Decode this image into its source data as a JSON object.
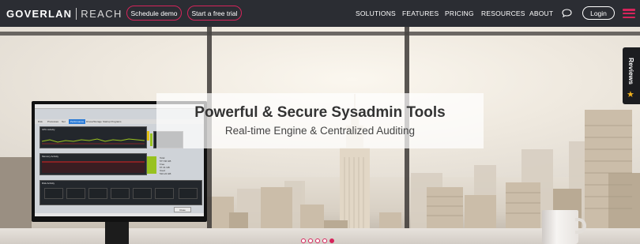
{
  "brand": {
    "logo_left": "GOVERLAN",
    "logo_right": "REACH",
    "accent_color": "#d6245b"
  },
  "nav": {
    "schedule_demo": "Schedule demo",
    "free_trial": "Start a free trial",
    "menu": [
      "SOLUTIONS",
      "FEATURES",
      "PRICING",
      "RESOURCES",
      "ABOUT"
    ],
    "chat_icon": "chat-bubble-icon",
    "login": "Login",
    "menu_icon": "hamburger-icon"
  },
  "hero": {
    "title": "Powerful & Secure Sysadmin Tools",
    "subtitle": "Real-time Engine & Centralized Auditing"
  },
  "screen": {
    "tabs": [
      "Disk",
      "Processes",
      "Net",
      "Performance",
      "Drives/Storage",
      "Startup Programs"
    ],
    "active_tab": "Performance",
    "panels": [
      "CPU Activity",
      "Memory Activity",
      "Disk Activity"
    ],
    "buttons": [
      "Close",
      "Save Stats"
    ],
    "memory_stats": [
      "Total",
      "577.66 GB",
      "Free",
      "67.41 GB",
      "Used",
      "510.24 GB"
    ]
  },
  "reviews_tab": {
    "label": "Reviews",
    "icon": "star-icon"
  },
  "carousel": {
    "slide_count": 5,
    "active_index": 4
  }
}
